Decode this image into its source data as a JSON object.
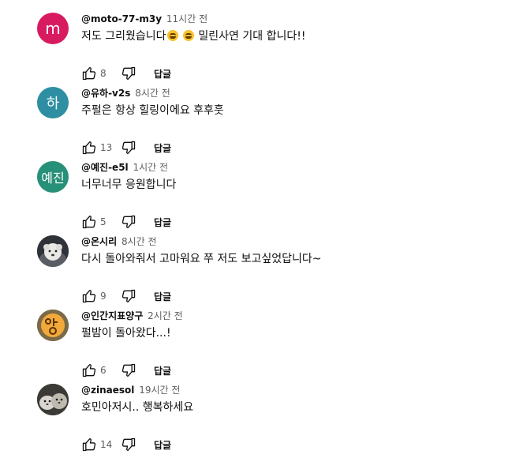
{
  "comments": [
    {
      "avatar_text": "m",
      "avatar_color": "#d81b60",
      "author": "@moto-77-m3y",
      "time": "11시간 전",
      "text_before": "저도 그리웠습니다",
      "text_after": " 밀린사연 기대 합니다!!",
      "emojis": [
        "grinning-sweat-emoji",
        "grinning-sweat-emoji"
      ],
      "likes": "8",
      "reply_label": "답글"
    },
    {
      "avatar_text": "하",
      "avatar_color": "#2e8fa3",
      "author": "@유하-v2s",
      "time": "8시간 전",
      "text": "주펄은 항상 힐링이에요 후후훗",
      "likes": "13",
      "reply_label": "답글"
    },
    {
      "avatar_text": "예진",
      "avatar_color": "#279078",
      "author": "@예진-e5l",
      "time": "1시간 전",
      "text": "너무너무 응원합니다",
      "likes": "5",
      "reply_label": "답글"
    },
    {
      "avatar_image": "white-dog-photo",
      "author": "@온시리",
      "time": "8시간 전",
      "text": "다시 돌아와줘서 고마워요 쭈 저도 보고싶었답니다~",
      "likes": "9",
      "reply_label": "답글"
    },
    {
      "avatar_image": "yang-character-logo",
      "author": "@인간지표양구",
      "time": "2시간 전",
      "text": "펄밤이 돌아왔다...!",
      "likes": "6",
      "reply_label": "답글"
    },
    {
      "avatar_image": "seal-photo",
      "author": "@zinaesol",
      "time": "19시간 전",
      "text": "호민아저시.. 행복하세요",
      "likes": "14",
      "reply_label": "답글"
    }
  ]
}
